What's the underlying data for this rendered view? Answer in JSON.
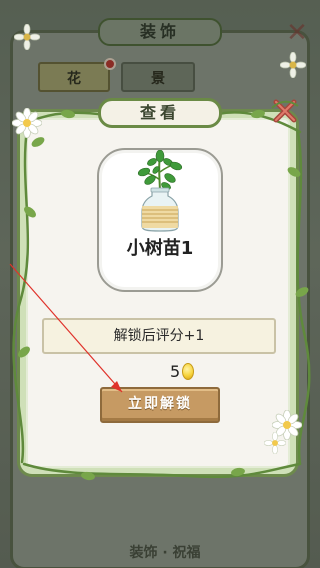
{
  "background_screen": {
    "title": "装饰",
    "tabs": [
      {
        "label": "花"
      },
      {
        "label": "景"
      }
    ],
    "bottom_tabs": "装饰 · 祝福"
  },
  "dialog": {
    "title": "查看",
    "item": {
      "name": "小树苗1",
      "icon": "sapling-in-jar-icon"
    },
    "condition": "解锁后评分+1",
    "price": {
      "amount": "5",
      "currency_icon": "gold-egg-coin-icon"
    },
    "unlock_button": "立即解锁",
    "close_icon": "close-x-icon"
  },
  "colors": {
    "vine_green": "#5f8a3c",
    "button_tan": "#c69a63",
    "annotation_arrow": "#e0322b"
  }
}
